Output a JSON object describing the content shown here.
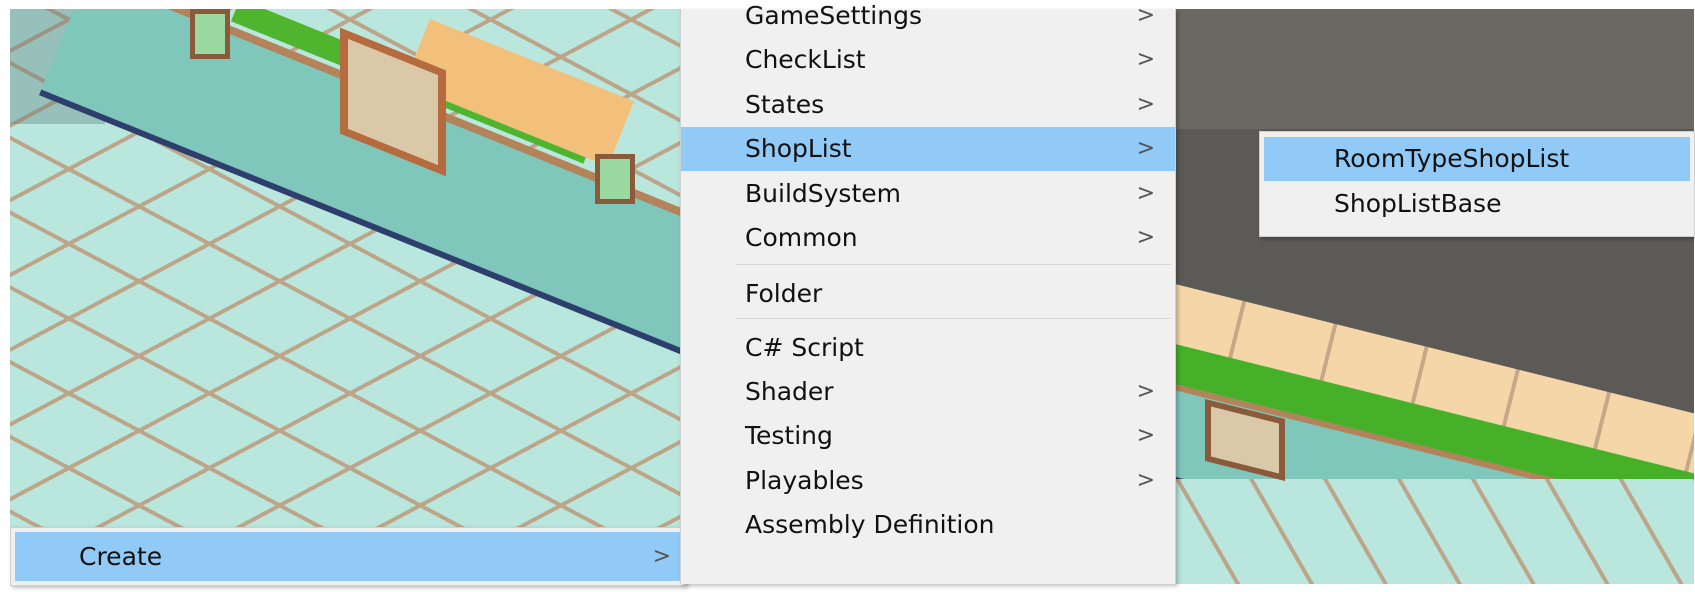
{
  "context_menu": {
    "create_label": "Create",
    "create_arrow": ">"
  },
  "create_submenu": {
    "items": [
      {
        "label": "GameSettings",
        "arrow": ">"
      },
      {
        "label": "CheckList",
        "arrow": ">"
      },
      {
        "label": "States",
        "arrow": ">"
      },
      {
        "label": "ShopList",
        "arrow": ">",
        "highlighted": true
      },
      {
        "label": "BuildSystem",
        "arrow": ">"
      },
      {
        "label": "Common",
        "arrow": ">"
      },
      {
        "label": "Folder",
        "arrow": ""
      },
      {
        "label": "C# Script",
        "arrow": ""
      },
      {
        "label": "Shader",
        "arrow": ">"
      },
      {
        "label": "Testing",
        "arrow": ">"
      },
      {
        "label": "Playables",
        "arrow": ">"
      },
      {
        "label": "Assembly Definition",
        "arrow": ""
      }
    ]
  },
  "shoplist_submenu": {
    "items": [
      {
        "label": "RoomTypeShopList",
        "highlighted": true
      },
      {
        "label": "ShopListBase"
      }
    ]
  },
  "colors": {
    "highlight": "#91c9f7",
    "menu_background": "#f0f0f0"
  }
}
